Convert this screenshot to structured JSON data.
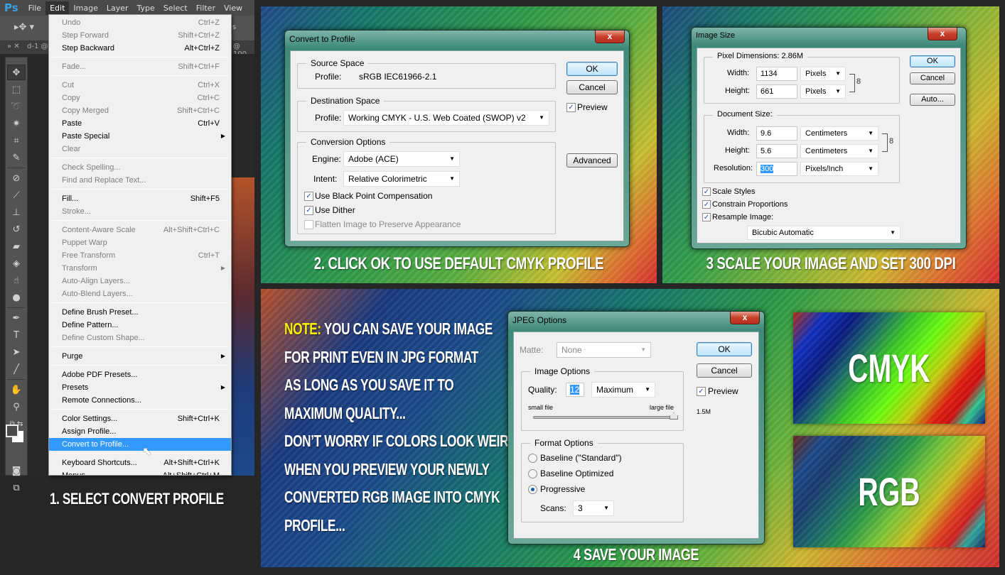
{
  "photoshop": {
    "logo": "Ps",
    "menubar": [
      "File",
      "Edit",
      "Image",
      "Layer",
      "Type",
      "Select",
      "Filter",
      "View"
    ],
    "active_menu": "Edit",
    "doc_tab": "d-1 @",
    "doc_zoom": "@ 100",
    "options_fragment": "ols",
    "tools": [
      "move-tool",
      "marquee-tool",
      "lasso-tool",
      "magic-wand-tool",
      "crop-tool",
      "eyedropper-tool",
      "healing-brush-tool",
      "brush-tool",
      "clone-stamp-tool",
      "history-brush-tool",
      "eraser-tool",
      "paint-bucket-tool",
      "smudge-tool",
      "dodge-tool",
      "pen-tool",
      "type-tool",
      "path-selection-tool",
      "line-tool",
      "hand-tool",
      "zoom-tool"
    ],
    "edit_menu": [
      {
        "label": "Undo",
        "shortcut": "Ctrl+Z",
        "enabled": false
      },
      {
        "label": "Step Forward",
        "shortcut": "Shift+Ctrl+Z",
        "enabled": false
      },
      {
        "label": "Step Backward",
        "shortcut": "Alt+Ctrl+Z",
        "enabled": true
      },
      {
        "sep": true
      },
      {
        "label": "Fade...",
        "shortcut": "Shift+Ctrl+F",
        "enabled": false
      },
      {
        "sep": true
      },
      {
        "label": "Cut",
        "shortcut": "Ctrl+X",
        "enabled": false
      },
      {
        "label": "Copy",
        "shortcut": "Ctrl+C",
        "enabled": false
      },
      {
        "label": "Copy Merged",
        "shortcut": "Shift+Ctrl+C",
        "enabled": false
      },
      {
        "label": "Paste",
        "shortcut": "Ctrl+V",
        "enabled": true
      },
      {
        "label": "Paste Special",
        "shortcut": "",
        "enabled": true,
        "submenu": true
      },
      {
        "label": "Clear",
        "shortcut": "",
        "enabled": false
      },
      {
        "sep": true
      },
      {
        "label": "Check Spelling...",
        "shortcut": "",
        "enabled": false
      },
      {
        "label": "Find and Replace Text...",
        "shortcut": "",
        "enabled": false
      },
      {
        "sep": true
      },
      {
        "label": "Fill...",
        "shortcut": "Shift+F5",
        "enabled": true
      },
      {
        "label": "Stroke...",
        "shortcut": "",
        "enabled": false
      },
      {
        "sep": true
      },
      {
        "label": "Content-Aware Scale",
        "shortcut": "Alt+Shift+Ctrl+C",
        "enabled": false
      },
      {
        "label": "Puppet Warp",
        "shortcut": "",
        "enabled": false
      },
      {
        "label": "Free Transform",
        "shortcut": "Ctrl+T",
        "enabled": false
      },
      {
        "label": "Transform",
        "shortcut": "",
        "enabled": false,
        "submenu": true
      },
      {
        "label": "Auto-Align Layers...",
        "shortcut": "",
        "enabled": false
      },
      {
        "label": "Auto-Blend Layers...",
        "shortcut": "",
        "enabled": false
      },
      {
        "sep": true
      },
      {
        "label": "Define Brush Preset...",
        "shortcut": "",
        "enabled": true
      },
      {
        "label": "Define Pattern...",
        "shortcut": "",
        "enabled": true
      },
      {
        "label": "Define Custom Shape...",
        "shortcut": "",
        "enabled": false
      },
      {
        "sep": true
      },
      {
        "label": "Purge",
        "shortcut": "",
        "enabled": true,
        "submenu": true
      },
      {
        "sep": true
      },
      {
        "label": "Adobe PDF Presets...",
        "shortcut": "",
        "enabled": true
      },
      {
        "label": "Presets",
        "shortcut": "",
        "enabled": true,
        "submenu": true
      },
      {
        "label": "Remote Connections...",
        "shortcut": "",
        "enabled": true
      },
      {
        "sep": true
      },
      {
        "label": "Color Settings...",
        "shortcut": "Shift+Ctrl+K",
        "enabled": true
      },
      {
        "label": "Assign Profile...",
        "shortcut": "",
        "enabled": true
      },
      {
        "label": "Convert to Profile...",
        "shortcut": "",
        "enabled": true,
        "highlighted": true
      },
      {
        "sep": true
      },
      {
        "label": "Keyboard Shortcuts...",
        "shortcut": "Alt+Shift+Ctrl+K",
        "enabled": true
      },
      {
        "label": "Menus...",
        "shortcut": "Alt+Shift+Ctrl+M",
        "enabled": true
      }
    ]
  },
  "captions": {
    "step1": "1. Select Convert Profile",
    "step2": "2. Click OK to use default CMYK profile",
    "step3": "3  Scale your image and set 300 DPI",
    "step4": "4  Save your image"
  },
  "convert_dialog": {
    "title": "Convert to Profile",
    "close": "x",
    "source_space": {
      "title": "Source Space",
      "profile_label": "Profile:",
      "profile_value": "sRGB IEC61966-2.1"
    },
    "destination_space": {
      "title": "Destination Space",
      "profile_label": "Profile:",
      "profile_value": "Working CMYK - U.S. Web Coated (SWOP) v2"
    },
    "conversion_options": {
      "title": "Conversion Options",
      "engine_label": "Engine:",
      "engine_value": "Adobe (ACE)",
      "intent_label": "Intent:",
      "intent_value": "Relative Colorimetric",
      "black_point": {
        "label": "Use Black Point Compensation",
        "checked": true
      },
      "dither": {
        "label": "Use Dither",
        "checked": true
      },
      "flatten": {
        "label": "Flatten Image to Preserve Appearance",
        "checked": false,
        "enabled": false
      }
    },
    "ok": "OK",
    "cancel": "Cancel",
    "advanced": "Advanced",
    "preview": {
      "label": "Preview",
      "checked": true
    }
  },
  "image_size_dialog": {
    "title": "Image Size",
    "close": "x",
    "pixel_dimensions": {
      "title": "Pixel Dimensions:",
      "size": "2.86M",
      "width_label": "Width:",
      "width": "1134",
      "width_unit": "Pixels",
      "height_label": "Height:",
      "height": "661",
      "height_unit": "Pixels"
    },
    "document_size": {
      "title": "Document Size:",
      "width_label": "Width:",
      "width": "9.6",
      "width_unit": "Centimeters",
      "height_label": "Height:",
      "height": "5.6",
      "height_unit": "Centimeters",
      "resolution_label": "Resolution:",
      "resolution": "300",
      "resolution_unit": "Pixels/Inch"
    },
    "scale_styles": {
      "label": "Scale Styles",
      "checked": true
    },
    "constrain": {
      "label": "Constrain Proportions",
      "checked": true
    },
    "resample": {
      "label": "Resample Image:",
      "checked": true,
      "method": "Bicubic Automatic"
    },
    "ok": "OK",
    "cancel": "Cancel",
    "auto": "Auto..."
  },
  "jpeg_dialog": {
    "title": "JPEG Options",
    "close": "x",
    "matte_label": "Matte:",
    "matte_value": "None",
    "image_options": {
      "title": "Image Options",
      "quality_label": "Quality:",
      "quality": "12",
      "quality_preset": "Maximum",
      "small_file": "small file",
      "large_file": "large file",
      "slider_value": 12,
      "slider_max": 12
    },
    "format_options": {
      "title": "Format Options",
      "options": [
        {
          "label": "Baseline (\"Standard\")",
          "selected": false
        },
        {
          "label": "Baseline Optimized",
          "selected": false
        },
        {
          "label": "Progressive",
          "selected": true
        }
      ],
      "scans_label": "Scans:",
      "scans": "3"
    },
    "ok": "OK",
    "cancel": "Cancel",
    "preview": {
      "label": "Preview",
      "checked": true
    },
    "file_size": "1.5M"
  },
  "note": {
    "label": "Note:",
    "lines": [
      " You can save your image",
      "for print even in JPG format",
      "as long as you save it to",
      "maximum quality...",
      "Don’t worry if colors look weird",
      "when you preview your newly",
      "converted RGB image into CMYK",
      "profile..."
    ]
  },
  "swatches": {
    "cmyk": "CMYK",
    "rgb": "RGB"
  }
}
